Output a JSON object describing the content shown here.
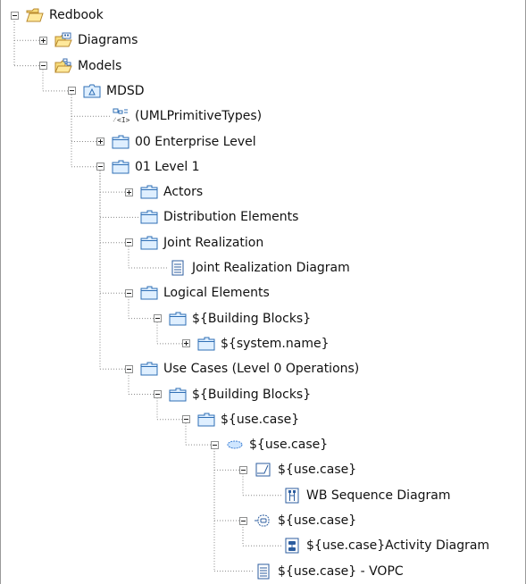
{
  "tree": {
    "nodes": [
      {
        "id": "n0",
        "label": "Redbook",
        "depth": 0,
        "toggle": "minus",
        "icon": "open-folder-icon"
      },
      {
        "id": "n1",
        "label": "Diagrams",
        "depth": 1,
        "toggle": "plus",
        "icon": "diagrams-folder-icon"
      },
      {
        "id": "n2",
        "label": "Models",
        "depth": 1,
        "toggle": "minus",
        "icon": "models-folder-icon"
      },
      {
        "id": "n3",
        "label": "MDSD",
        "depth": 2,
        "toggle": "minus",
        "icon": "model-icon"
      },
      {
        "id": "n4",
        "label": "(UMLPrimitiveTypes)",
        "depth": 3,
        "toggle": "none",
        "icon": "library-import-icon"
      },
      {
        "id": "n5",
        "label": "00 Enterprise Level",
        "depth": 3,
        "toggle": "plus",
        "icon": "package-icon"
      },
      {
        "id": "n6",
        "label": "01 Level 1",
        "depth": 3,
        "toggle": "minus",
        "icon": "package-icon"
      },
      {
        "id": "n7",
        "label": "Actors",
        "depth": 4,
        "toggle": "plus",
        "icon": "package-icon"
      },
      {
        "id": "n8",
        "label": "Distribution Elements",
        "depth": 4,
        "toggle": "none",
        "icon": "package-icon"
      },
      {
        "id": "n9",
        "label": "Joint Realization",
        "depth": 4,
        "toggle": "minus",
        "icon": "package-icon"
      },
      {
        "id": "n10",
        "label": "Joint Realization Diagram",
        "depth": 5,
        "toggle": "none",
        "icon": "diagram-icon"
      },
      {
        "id": "n11",
        "label": "Logical Elements",
        "depth": 4,
        "toggle": "minus",
        "icon": "package-icon"
      },
      {
        "id": "n12",
        "label": "${Building Blocks}",
        "depth": 5,
        "toggle": "minus",
        "icon": "package-icon"
      },
      {
        "id": "n13",
        "label": "${system.name}",
        "depth": 6,
        "toggle": "plus",
        "icon": "package-icon"
      },
      {
        "id": "n14",
        "label": "Use Cases (Level 0 Operations)",
        "depth": 4,
        "toggle": "minus",
        "icon": "package-icon"
      },
      {
        "id": "n15",
        "label": "${Building Blocks}",
        "depth": 5,
        "toggle": "minus",
        "icon": "package-icon"
      },
      {
        "id": "n16",
        "label": "${use.case}",
        "depth": 6,
        "toggle": "minus",
        "icon": "package-icon"
      },
      {
        "id": "n17",
        "label": "${use.case}",
        "depth": 7,
        "toggle": "minus",
        "icon": "use-case-icon"
      },
      {
        "id": "n18",
        "label": "${use.case}",
        "depth": 8,
        "toggle": "minus",
        "icon": "interaction-icon"
      },
      {
        "id": "n19",
        "label": "WB Sequence Diagram",
        "depth": 9,
        "toggle": "none",
        "icon": "sequence-diagram-icon"
      },
      {
        "id": "n20",
        "label": "${use.case}",
        "depth": 8,
        "toggle": "minus",
        "icon": "activity-icon"
      },
      {
        "id": "n21",
        "label": "${use.case}Activity Diagram",
        "depth": 9,
        "toggle": "none",
        "icon": "activity-diagram-icon"
      },
      {
        "id": "n22",
        "label": "${use.case} - VOPC",
        "depth": 8,
        "toggle": "none",
        "icon": "diagram-icon"
      }
    ]
  },
  "colors": {
    "folder_fill": "#f7dc7b",
    "folder_stroke": "#b8892e",
    "package_fill": "#dfefff",
    "package_stroke": "#2f6fb5",
    "guide_line": "#8a8a8a"
  }
}
